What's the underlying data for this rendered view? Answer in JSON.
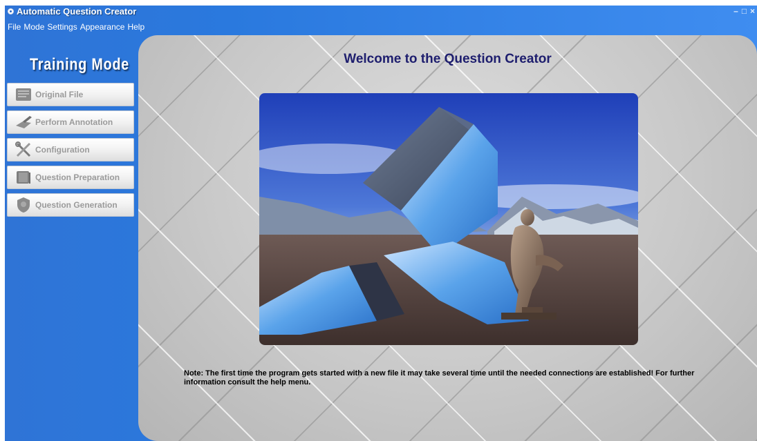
{
  "window": {
    "title": "Automatic Question Creator",
    "controls": [
      "–",
      "□",
      "×"
    ]
  },
  "menu": [
    "File",
    "Mode",
    "Settings",
    "Appearance",
    "Help"
  ],
  "sidebar": {
    "title": "Training Mode",
    "items": [
      {
        "label": "Original File",
        "icon": "document-icon"
      },
      {
        "label": "Perform Annotation",
        "icon": "pen-icon"
      },
      {
        "label": "Configuration",
        "icon": "tools-icon"
      },
      {
        "label": "Question Preparation",
        "icon": "book-icon"
      },
      {
        "label": "Question Generation",
        "icon": "shield-question-icon"
      }
    ]
  },
  "main": {
    "welcome": "Welcome to the Question Creator",
    "image": "thinker-sculpture-on-question-mark-landscape",
    "note": "Note: The first time the program gets started with a new file it may take several time until the needed connections are established! For further information consult the help menu."
  },
  "colors": {
    "sidebar_blue": "#2f74d6",
    "welcome_text": "#1e1e6e",
    "nav_label": "#9a9a9a"
  }
}
